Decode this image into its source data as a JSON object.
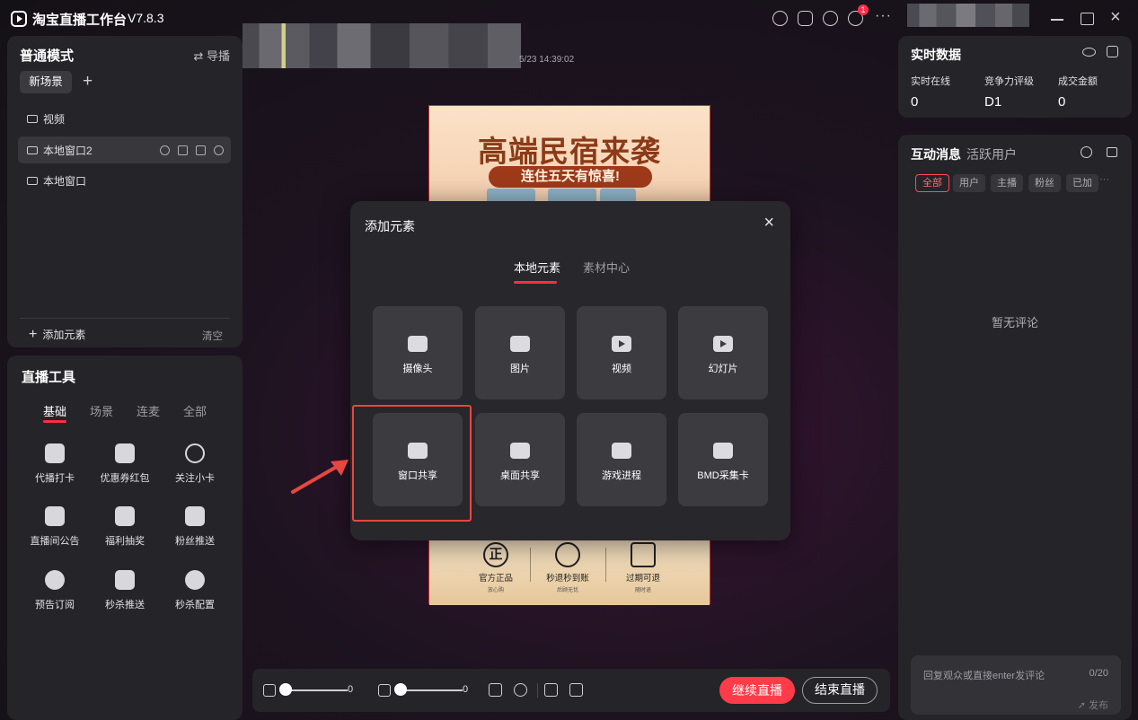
{
  "app": {
    "title": "淘宝直播工作台",
    "version": "V7.8.3",
    "notification_count": "1",
    "more": "···"
  },
  "scene_panel": {
    "title": "普通模式",
    "director": "⇄ 导播",
    "tab": "新场景",
    "add": "+",
    "sources": [
      "视频",
      "本地窗口2",
      "本地窗口"
    ],
    "add_element": "添加元素",
    "clear": "清空"
  },
  "tools_panel": {
    "title": "直播工具",
    "tabs": [
      "基础",
      "场景",
      "连麦",
      "全部"
    ],
    "tools": [
      "代播打卡",
      "优惠券红包",
      "关注小卡",
      "直播间公告",
      "福利抽奖",
      "粉丝推送",
      "预告订阅",
      "秒杀推送",
      "秒杀配置"
    ]
  },
  "preview": {
    "timestamp": "5/23 14:39:02",
    "title": "高端民宿来袭",
    "subtitle": "连住五天有惊喜!",
    "badges": [
      {
        "icon": "正",
        "line1": "官方正品",
        "line2": "放心购"
      },
      {
        "icon": "",
        "line1": "秒退秒到账",
        "line2": "后顾无忧"
      },
      {
        "icon": "",
        "line1": "过期可退",
        "line2": "随时退"
      }
    ]
  },
  "modal": {
    "title": "添加元素",
    "close": "×",
    "tabs": [
      "本地元素",
      "素材中心"
    ],
    "tiles": [
      "摄像头",
      "图片",
      "视频",
      "幻灯片",
      "窗口共享",
      "桌面共享",
      "游戏进程",
      "BMD采集卡"
    ]
  },
  "bottom_bar": {
    "speaker_volume": "0",
    "mic_volume": "0",
    "continue_label": "继续直播",
    "end_label": "结束直播"
  },
  "data_panel": {
    "title": "实时数据",
    "metrics": [
      {
        "label": "实时在线",
        "value": "0"
      },
      {
        "label": "竞争力评级",
        "value": "D1"
      },
      {
        "label": "成交金额",
        "value": "0"
      }
    ]
  },
  "message_panel": {
    "title": "互动消息",
    "title2": "活跃用户",
    "filters": [
      "全部",
      "用户",
      "主播",
      "粉丝",
      "已加"
    ],
    "more": "···",
    "empty": "暂无评论",
    "reply_placeholder": "回复观众或直接enter发评论",
    "reply_count": "0/20",
    "send": "发布"
  },
  "colors": {
    "accent": "#ff3b4a",
    "panel": "#252428",
    "tile": "#3c3b40",
    "highlight": "#e8473f"
  }
}
